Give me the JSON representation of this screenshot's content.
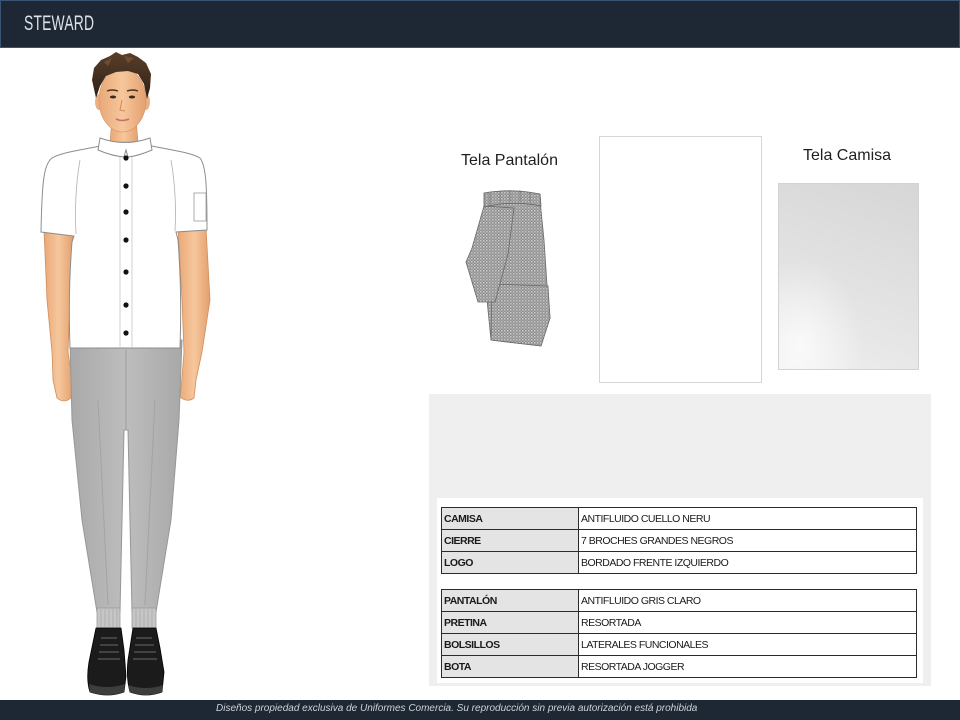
{
  "header": {
    "title": "STEWARD"
  },
  "fabric_labels": {
    "pants": "Tela Pantalón",
    "shirt": "Tela Camisa"
  },
  "spec_tables": [
    {
      "rows": [
        {
          "label": "CAMISA",
          "value": "ANTIFLUIDO CUELLO NERU"
        },
        {
          "label": "CIERRE",
          "value": "7 BROCHES GRANDES NEGROS"
        },
        {
          "label": "LOGO",
          "value": "BORDADO FRENTE IZQUIERDO"
        }
      ]
    },
    {
      "rows": [
        {
          "label": "PANTALÓN",
          "value": "ANTIFLUIDO GRIS CLARO"
        },
        {
          "label": "PRETINA",
          "value": "RESORTADA"
        },
        {
          "label": "BOLSILLOS",
          "value": "LATERALES FUNCIONALES"
        },
        {
          "label": "BOTA",
          "value": "RESORTADA JOGGER"
        }
      ]
    }
  ],
  "footer": {
    "text": "Diseños propiedad exclusiva de Uniformes Comercia. Su reproducción sin previa autorización está prohibida"
  },
  "colors": {
    "header_bg": "#1e2734",
    "footer_bg": "#1e2734",
    "label_cell_bg": "#e4e4e4",
    "panel_bg": "#efefef",
    "shirt": "#ffffff",
    "pants": "#b6b6b6",
    "shoes": "#1b1b1b",
    "buttons": "#111111"
  }
}
